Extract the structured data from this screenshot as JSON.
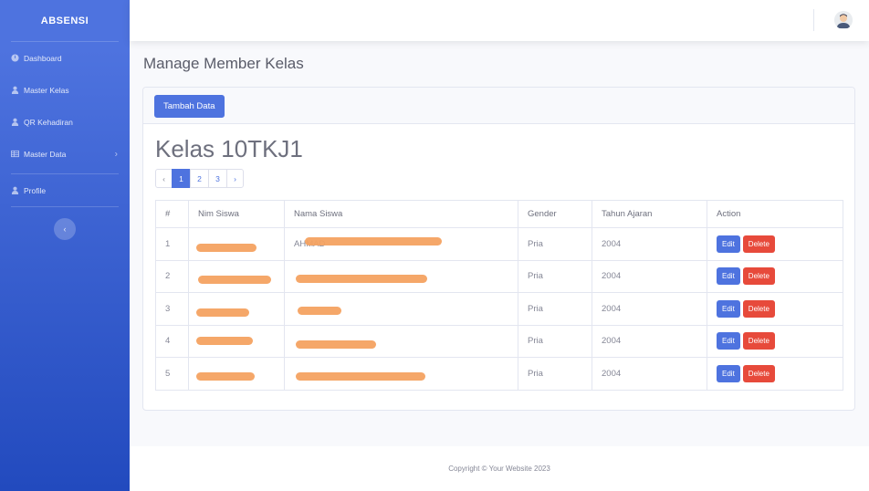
{
  "brand": "ABSENSI",
  "sidebar": {
    "items": [
      {
        "label": "Dashboard",
        "icon": "dashboard-icon"
      },
      {
        "label": "Master Kelas",
        "icon": "user-icon"
      },
      {
        "label": "QR Kehadiran",
        "icon": "user-icon"
      },
      {
        "label": "Master Data",
        "icon": "table-icon",
        "has_submenu": true
      },
      {
        "label": "Profile",
        "icon": "user-icon"
      }
    ],
    "toggle_icon": "‹"
  },
  "page": {
    "title": "Manage Member Kelas",
    "add_button": "Tambah Data",
    "class_title": "Kelas 10TKJ1"
  },
  "pagination": {
    "prev": "‹",
    "pages": [
      "1",
      "2",
      "3"
    ],
    "active": "1",
    "next": "›"
  },
  "table": {
    "headers": [
      "#",
      "Nim Siswa",
      "Nama Siswa",
      "Gender",
      "Tahun Ajaran",
      "Action"
    ],
    "rows": [
      {
        "no": "1",
        "nim": "",
        "nama": "AHMAD",
        "gender": "Pria",
        "tahun": "2004"
      },
      {
        "no": "2",
        "nim": "",
        "nama": "",
        "gender": "Pria",
        "tahun": "2004"
      },
      {
        "no": "3",
        "nim": "",
        "nama": "",
        "gender": "Pria",
        "tahun": "2004"
      },
      {
        "no": "4",
        "nim": "",
        "nama": "",
        "gender": "Pria",
        "tahun": "2004"
      },
      {
        "no": "5",
        "nim": "",
        "nama": "",
        "gender": "Pria",
        "tahun": "2004"
      }
    ],
    "edit_label": "Edit",
    "delete_label": "Delete"
  },
  "footer": "Copyright © Your Website 2023",
  "colors": {
    "primary": "#4e73df",
    "danger": "#e74a3b",
    "redaction": "#f4a261"
  }
}
